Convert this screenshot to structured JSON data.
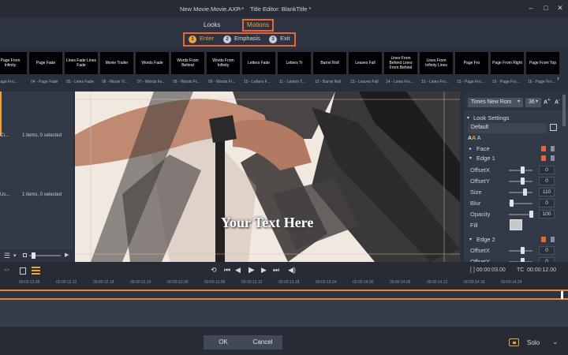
{
  "titlebar": {
    "document": "New Movie.Movie.AXP *",
    "separator": ">",
    "editor": "Title Editor: BlankTitle *",
    "minimize": "–",
    "maximize": "□",
    "close": "✕"
  },
  "tabs": {
    "looks": "Looks",
    "motions": "Motions"
  },
  "motion_phases": [
    {
      "num": "1",
      "label": "Enter"
    },
    {
      "num": "2",
      "label": "Emphasis"
    },
    {
      "num": "3",
      "label": "Exit"
    }
  ],
  "presets": [
    {
      "thumb": "Page From Infinity",
      "label": "- Page Fro..."
    },
    {
      "thumb": "Page Fade",
      "label": "04 - Page Fade"
    },
    {
      "thumb": "Lines Fade Lines Fade",
      "label": "05 - Lines Fade"
    },
    {
      "thumb": "Movie Trailer",
      "label": "06 - Movie Tr..."
    },
    {
      "thumb": "Words Fade",
      "label": "07 - Words Fa..."
    },
    {
      "thumb": "Words From Behind",
      "label": "08 - Words Fr..."
    },
    {
      "thumb": "Words From Infinity",
      "label": "09 - Words Fr..."
    },
    {
      "thumb": "Letters Fade",
      "label": "10 - Letters F..."
    },
    {
      "thumb": "Letters Tr",
      "label": "11 - Letters T..."
    },
    {
      "thumb": "Barrel Roll",
      "label": "12 - Barrel Roll"
    },
    {
      "thumb": "Leaves Fall",
      "label": "13 - Leaves Fall"
    },
    {
      "thumb": "Lines From Behind Lines From Behind",
      "label": "14 - Lines Fro..."
    },
    {
      "thumb": "Lines From Infinity Lines",
      "label": "15 - Lines Fro..."
    },
    {
      "thumb": "Page Fro",
      "label": "15 - Page Fro..."
    },
    {
      "thumb": "Page From Right",
      "label": "16 - Page Fro..."
    },
    {
      "thumb": "Page From Top",
      "label": "16 - Page Fro..."
    }
  ],
  "left_panel": {
    "row1_path": "C\\...",
    "row1_status": "1 items, 0 selected",
    "row2_path": "Us...",
    "row2_status": "1 items, 0 selected"
  },
  "preview": {
    "text": "Your Text Here"
  },
  "right_panel": {
    "font": "Times New Rom",
    "size": "36",
    "look_settings": "Look Settings",
    "preset": "Default",
    "face": "Face",
    "edge1": "Edge 1",
    "edge2": "Edge 2",
    "props": [
      {
        "name": "OffsetX",
        "value": "0"
      },
      {
        "name": "OffsetY",
        "value": "0"
      },
      {
        "name": "Size",
        "value": "110"
      },
      {
        "name": "Blur",
        "value": "0"
      },
      {
        "name": "Opacity",
        "value": "100"
      },
      {
        "name": "Fill",
        "value": ""
      }
    ],
    "props2": [
      {
        "name": "OffsetX",
        "value": "0"
      },
      {
        "name": "OffsetY",
        "value": "0"
      }
    ]
  },
  "transport": {
    "duration": "[ ] 00:00:03.00",
    "tc_label": "TC",
    "timecode": "00:00:12.00"
  },
  "ruler_ticks": [
    "00:00:12.06",
    "00:00:12.12",
    "00:00:12.18",
    "00:00:12.24",
    "00:00:13.00",
    "00:00:13.06",
    "00:00:13.12",
    "00:00:13.18",
    "00:00:13.24",
    "00:00:14.00",
    "00:00:14.06",
    "00:00:14.12",
    "00:00:14.18",
    "00:00:14.24"
  ],
  "bottom": {
    "ok": "OK",
    "cancel": "Cancel",
    "solo": "Solo"
  },
  "colors": {
    "accent": "#e8643a",
    "highlight": "#f0a13a"
  }
}
